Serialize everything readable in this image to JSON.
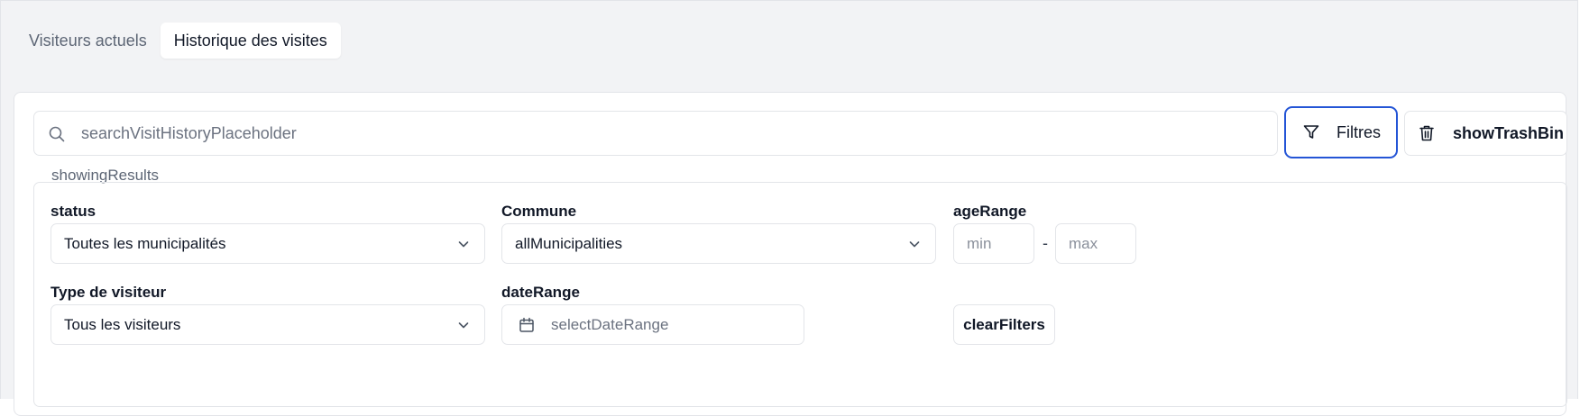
{
  "tabs": [
    {
      "label": "Visiteurs actuels",
      "active": false
    },
    {
      "label": "Historique des visites",
      "active": true
    }
  ],
  "search": {
    "placeholder": "searchVisitHistoryPlaceholder",
    "icon": "search-icon"
  },
  "toolbar": {
    "filters_label": "Filtres",
    "filters_icon": "filter-icon",
    "trash_label": "showTrashBin",
    "trash_icon": "trash-icon",
    "accent_color": "#2455d6"
  },
  "results": {
    "text": "showingResults"
  },
  "filters": {
    "status": {
      "label": "status",
      "value": "Toutes les municipalités"
    },
    "commune": {
      "label": "Commune",
      "value": "allMunicipalities"
    },
    "age_range": {
      "label": "ageRange",
      "min_placeholder": "min",
      "max_placeholder": "max",
      "separator": "-"
    },
    "visitor_type": {
      "label": "Type de visiteur",
      "value": "Tous les visiteurs"
    },
    "date_range": {
      "label": "dateRange",
      "placeholder": "selectDateRange",
      "icon": "calendar-icon"
    },
    "clear_label": "clearFilters"
  }
}
